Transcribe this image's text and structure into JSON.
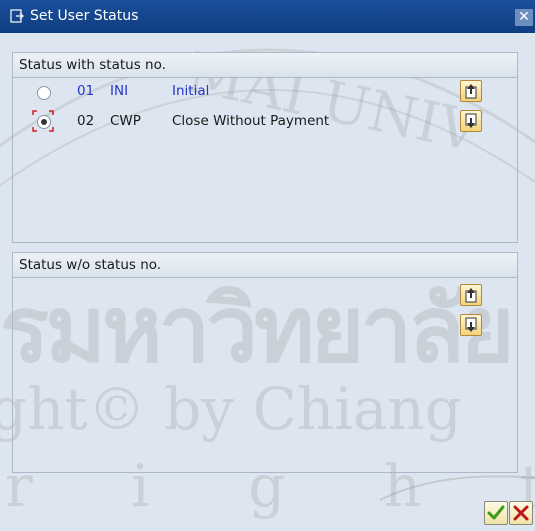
{
  "window": {
    "title": "Set User Status"
  },
  "status_with_number": {
    "header": "Status with status no.",
    "rows": [
      {
        "number": "01",
        "code": "INI",
        "description": "Initial",
        "selected": false
      },
      {
        "number": "02",
        "code": "CWP",
        "description": "Close Without Payment",
        "selected": true
      }
    ]
  },
  "status_without_number": {
    "header": "Status w/o status no."
  },
  "watermark": {
    "line1": "รมหาวิทยาลัย",
    "line2": "ght© by Chiang",
    "line3": "r i g h t s r",
    "arc_text": "MAI UNIV"
  },
  "icons": {
    "title": "window-icon",
    "scroll_up": "page-up-icon",
    "scroll_down": "page-down-icon",
    "confirm": "checkmark-icon",
    "cancel": "cross-icon"
  },
  "colors": {
    "titlebar": "#1a4f9b",
    "background": "#dde6f0",
    "link_text": "#2434c8",
    "confirm": "#3a9a1a",
    "cancel": "#c01818"
  }
}
